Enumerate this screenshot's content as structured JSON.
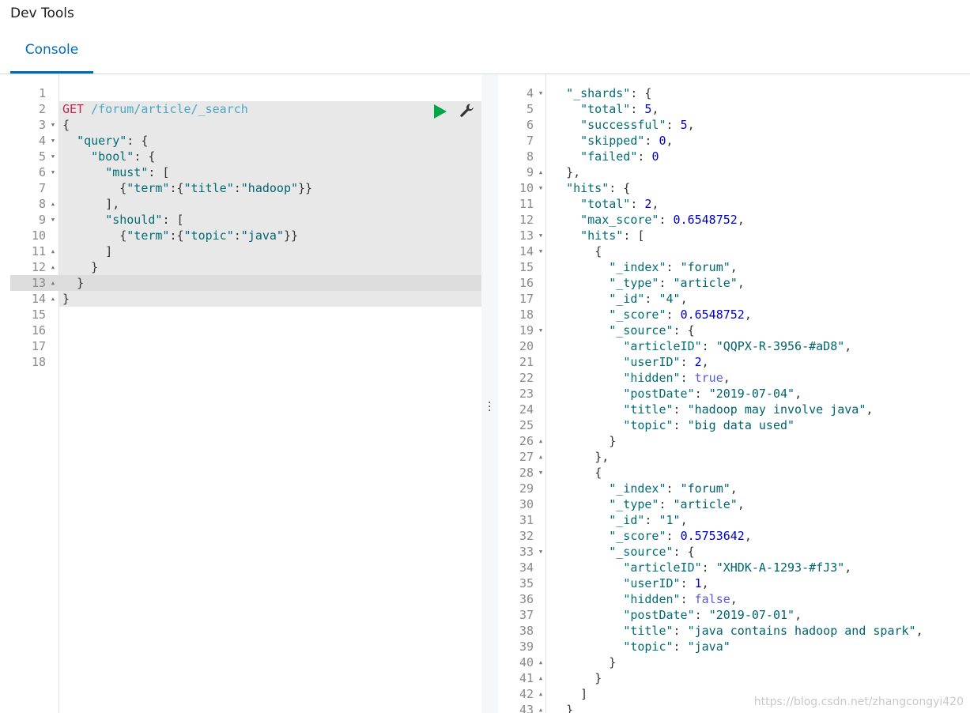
{
  "app": {
    "title": "Dev Tools"
  },
  "tabs": [
    {
      "label": "Console",
      "active": true
    }
  ],
  "request": {
    "method": "GET",
    "path": "/forum/article/_search",
    "lines": [
      {
        "n": "1",
        "fold": "",
        "html": ""
      },
      {
        "n": "2",
        "fold": "",
        "html": "REQ"
      },
      {
        "n": "3",
        "fold": "▼",
        "html": "<span class=\"p\">{</span>"
      },
      {
        "n": "4",
        "fold": "▼",
        "html": "  <span class=\"k\">\"query\"</span><span class=\"p\">: {</span>"
      },
      {
        "n": "5",
        "fold": "▼",
        "html": "    <span class=\"k\">\"bool\"</span><span class=\"p\">: {</span>"
      },
      {
        "n": "6",
        "fold": "▼",
        "html": "      <span class=\"k\">\"must\"</span><span class=\"p\">: [</span>"
      },
      {
        "n": "7",
        "fold": "",
        "html": "        <span class=\"p\">{</span><span class=\"k\">\"term\"</span><span class=\"p\">:{</span><span class=\"k\">\"title\"</span><span class=\"p\">:</span><span class=\"s\">\"hadoop\"</span><span class=\"p\">}}</span>"
      },
      {
        "n": "8",
        "fold": "▲",
        "html": "      <span class=\"p\">],</span>"
      },
      {
        "n": "9",
        "fold": "▼",
        "html": "      <span class=\"k\">\"should\"</span><span class=\"p\">: [</span>"
      },
      {
        "n": "10",
        "fold": "",
        "html": "        <span class=\"p\">{</span><span class=\"k\">\"term\"</span><span class=\"p\">:{</span><span class=\"k\">\"topic\"</span><span class=\"p\">:</span><span class=\"s\">\"java\"</span><span class=\"p\">}}</span>"
      },
      {
        "n": "11",
        "fold": "▲",
        "html": "      <span class=\"p\">]</span>"
      },
      {
        "n": "12",
        "fold": "▲",
        "html": "    <span class=\"p\">}</span>"
      },
      {
        "n": "13",
        "fold": "▲",
        "html": "  <span class=\"p\">}</span>"
      },
      {
        "n": "14",
        "fold": "▲",
        "html": "<span class=\"p\">}</span>"
      },
      {
        "n": "15",
        "fold": "",
        "html": ""
      },
      {
        "n": "16",
        "fold": "",
        "html": ""
      },
      {
        "n": "17",
        "fold": "",
        "html": ""
      },
      {
        "n": "18",
        "fold": "",
        "html": ""
      }
    ]
  },
  "response": {
    "lines": [
      {
        "n": "4",
        "fold": "▼",
        "html": "  <span class=\"k\">\"_shards\"</span><span class=\"p\">: {</span>"
      },
      {
        "n": "5",
        "fold": "",
        "html": "    <span class=\"k\">\"total\"</span><span class=\"p\">: </span><span class=\"n\">5</span><span class=\"p\">,</span>"
      },
      {
        "n": "6",
        "fold": "",
        "html": "    <span class=\"k\">\"successful\"</span><span class=\"p\">: </span><span class=\"n\">5</span><span class=\"p\">,</span>"
      },
      {
        "n": "7",
        "fold": "",
        "html": "    <span class=\"k\">\"skipped\"</span><span class=\"p\">: </span><span class=\"n\">0</span><span class=\"p\">,</span>"
      },
      {
        "n": "8",
        "fold": "",
        "html": "    <span class=\"k\">\"failed\"</span><span class=\"p\">: </span><span class=\"n\">0</span>"
      },
      {
        "n": "9",
        "fold": "▲",
        "html": "  <span class=\"p\">},</span>"
      },
      {
        "n": "10",
        "fold": "▼",
        "html": "  <span class=\"k\">\"hits\"</span><span class=\"p\">: {</span>"
      },
      {
        "n": "11",
        "fold": "",
        "html": "    <span class=\"k\">\"total\"</span><span class=\"p\">: </span><span class=\"n\">2</span><span class=\"p\">,</span>"
      },
      {
        "n": "12",
        "fold": "",
        "html": "    <span class=\"k\">\"max_score\"</span><span class=\"p\">: </span><span class=\"n\">0.6548752</span><span class=\"p\">,</span>"
      },
      {
        "n": "13",
        "fold": "▼",
        "html": "    <span class=\"k\">\"hits\"</span><span class=\"p\">: [</span>"
      },
      {
        "n": "14",
        "fold": "▼",
        "html": "      <span class=\"p\">{</span>"
      },
      {
        "n": "15",
        "fold": "",
        "html": "        <span class=\"k\">\"_index\"</span><span class=\"p\">: </span><span class=\"s\">\"forum\"</span><span class=\"p\">,</span>"
      },
      {
        "n": "16",
        "fold": "",
        "html": "        <span class=\"k\">\"_type\"</span><span class=\"p\">: </span><span class=\"s\">\"article\"</span><span class=\"p\">,</span>"
      },
      {
        "n": "17",
        "fold": "",
        "html": "        <span class=\"k\">\"_id\"</span><span class=\"p\">: </span><span class=\"s\">\"4\"</span><span class=\"p\">,</span>"
      },
      {
        "n": "18",
        "fold": "",
        "html": "        <span class=\"k\">\"_score\"</span><span class=\"p\">: </span><span class=\"n\">0.6548752</span><span class=\"p\">,</span>"
      },
      {
        "n": "19",
        "fold": "▼",
        "html": "        <span class=\"k\">\"_source\"</span><span class=\"p\">: {</span>"
      },
      {
        "n": "20",
        "fold": "",
        "html": "          <span class=\"k\">\"articleID\"</span><span class=\"p\">: </span><span class=\"s\">\"QQPX-R-3956-#aD8\"</span><span class=\"p\">,</span>"
      },
      {
        "n": "21",
        "fold": "",
        "html": "          <span class=\"k\">\"userID\"</span><span class=\"p\">: </span><span class=\"n\">2</span><span class=\"p\">,</span>"
      },
      {
        "n": "22",
        "fold": "",
        "html": "          <span class=\"k\">\"hidden\"</span><span class=\"p\">: </span><span class=\"b\">true</span><span class=\"p\">,</span>"
      },
      {
        "n": "23",
        "fold": "",
        "html": "          <span class=\"k\">\"postDate\"</span><span class=\"p\">: </span><span class=\"s\">\"2019-07-04\"</span><span class=\"p\">,</span>"
      },
      {
        "n": "24",
        "fold": "",
        "html": "          <span class=\"k\">\"title\"</span><span class=\"p\">: </span><span class=\"s\">\"hadoop may involve java\"</span><span class=\"p\">,</span>"
      },
      {
        "n": "25",
        "fold": "",
        "html": "          <span class=\"k\">\"topic\"</span><span class=\"p\">: </span><span class=\"s\">\"big data used\"</span>"
      },
      {
        "n": "26",
        "fold": "▲",
        "html": "        <span class=\"p\">}</span>"
      },
      {
        "n": "27",
        "fold": "▲",
        "html": "      <span class=\"p\">},</span>"
      },
      {
        "n": "28",
        "fold": "▼",
        "html": "      <span class=\"p\">{</span>"
      },
      {
        "n": "29",
        "fold": "",
        "html": "        <span class=\"k\">\"_index\"</span><span class=\"p\">: </span><span class=\"s\">\"forum\"</span><span class=\"p\">,</span>"
      },
      {
        "n": "30",
        "fold": "",
        "html": "        <span class=\"k\">\"_type\"</span><span class=\"p\">: </span><span class=\"s\">\"article\"</span><span class=\"p\">,</span>"
      },
      {
        "n": "31",
        "fold": "",
        "html": "        <span class=\"k\">\"_id\"</span><span class=\"p\">: </span><span class=\"s\">\"1\"</span><span class=\"p\">,</span>"
      },
      {
        "n": "32",
        "fold": "",
        "html": "        <span class=\"k\">\"_score\"</span><span class=\"p\">: </span><span class=\"n\">0.5753642</span><span class=\"p\">,</span>"
      },
      {
        "n": "33",
        "fold": "▼",
        "html": "        <span class=\"k\">\"_source\"</span><span class=\"p\">: {</span>"
      },
      {
        "n": "34",
        "fold": "",
        "html": "          <span class=\"k\">\"articleID\"</span><span class=\"p\">: </span><span class=\"s\">\"XHDK-A-1293-#fJ3\"</span><span class=\"p\">,</span>"
      },
      {
        "n": "35",
        "fold": "",
        "html": "          <span class=\"k\">\"userID\"</span><span class=\"p\">: </span><span class=\"n\">1</span><span class=\"p\">,</span>"
      },
      {
        "n": "36",
        "fold": "",
        "html": "          <span class=\"k\">\"hidden\"</span><span class=\"p\">: </span><span class=\"b\">false</span><span class=\"p\">,</span>"
      },
      {
        "n": "37",
        "fold": "",
        "html": "          <span class=\"k\">\"postDate\"</span><span class=\"p\">: </span><span class=\"s\">\"2019-07-01\"</span><span class=\"p\">,</span>"
      },
      {
        "n": "38",
        "fold": "",
        "html": "          <span class=\"k\">\"title\"</span><span class=\"p\">: </span><span class=\"s\">\"java contains hadoop and spark\"</span><span class=\"p\">,</span>"
      },
      {
        "n": "39",
        "fold": "",
        "html": "          <span class=\"k\">\"topic\"</span><span class=\"p\">: </span><span class=\"s\">\"java\"</span>"
      },
      {
        "n": "40",
        "fold": "▲",
        "html": "        <span class=\"p\">}</span>"
      },
      {
        "n": "41",
        "fold": "▲",
        "html": "      <span class=\"p\">}</span>"
      },
      {
        "n": "42",
        "fold": "▲",
        "html": "    <span class=\"p\">]</span>"
      },
      {
        "n": "43",
        "fold": "▲",
        "html": "  <span class=\"p\">}</span>"
      }
    ]
  },
  "watermark": "https://blog.csdn.net/zhangcongyi420"
}
